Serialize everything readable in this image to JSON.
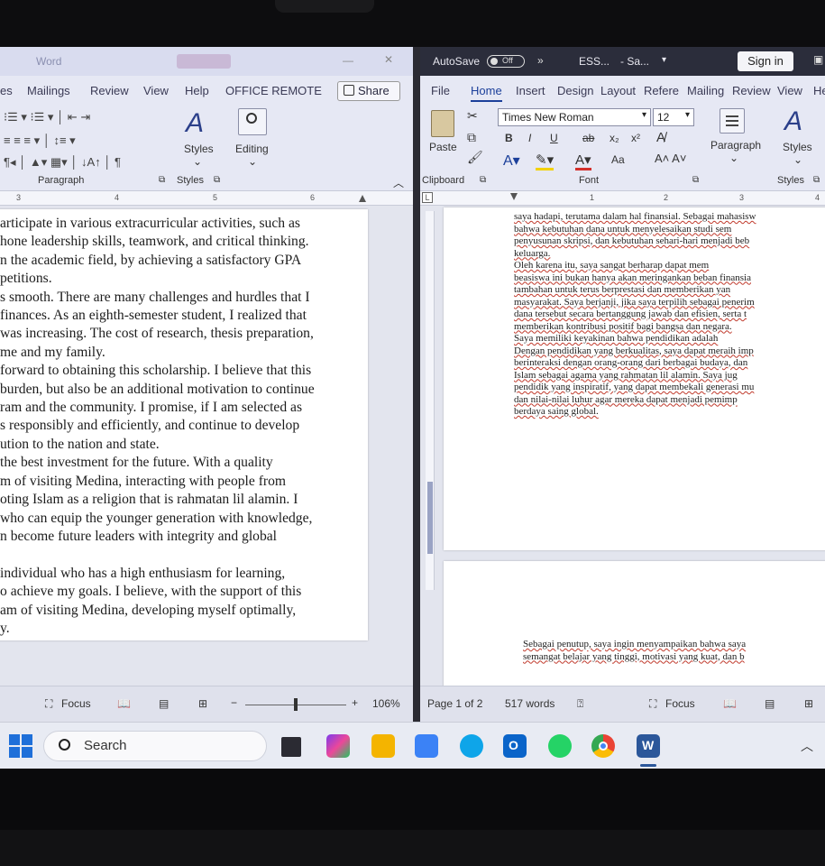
{
  "left_window": {
    "title_fragment": "Word",
    "menu_tabs": [
      "es",
      "Mailings",
      "Review",
      "View",
      "Help",
      "OFFICE REMOTE"
    ],
    "share_label": "Share",
    "groups": {
      "paragraph": "Paragraph",
      "styles_group": "Styles",
      "styles_button": "Styles",
      "editing_button": "Editing"
    },
    "ruler_marks": [
      "3",
      "4",
      "5",
      "6"
    ],
    "document_lines": [
      "articipate in various extracurricular activities, such as",
      "hone leadership skills, teamwork, and critical thinking.",
      "n the academic field, by achieving a satisfactory GPA",
      "petitions.",
      "s smooth. There are many challenges and hurdles that I",
      "finances. As an eighth-semester student, I realized that",
      "was increasing. The cost of research, thesis preparation,",
      "me and my family.",
      "forward to obtaining this scholarship. I believe that this",
      "burden, but also be an additional motivation to continue",
      "ram and the community. I promise, if I am selected as",
      "s responsibly and efficiently, and continue to develop",
      "ution to the nation and state.",
      "the best investment for the future. With a quality",
      "m of visiting Medina, interacting with people from",
      "oting Islam as a religion that is rahmatan lil alamin. I",
      "who can equip the younger generation with knowledge,",
      "n become future leaders with integrity and global",
      "",
      "individual who has a high enthusiasm for learning,",
      "o achieve my goals. I believe, with the support of this",
      "am of visiting Medina, developing myself optimally,",
      "y."
    ],
    "status": {
      "focus": "Focus",
      "zoom": "106%",
      "minus": "−",
      "plus": "+"
    }
  },
  "right_window": {
    "autosave": "AutoSave",
    "toggle": "Off",
    "doc_name": "ESS...",
    "saved": "- Sa...",
    "sign_in": "Sign in",
    "menu_tabs": [
      "File",
      "Home",
      "Insert",
      "Design",
      "Layout",
      "Refere",
      "Mailing",
      "Review",
      "View",
      "He"
    ],
    "clipboard": {
      "paste": "Paste",
      "label": "Clipboard"
    },
    "font": {
      "name": "Times New Roman",
      "size": "12",
      "label": "Font",
      "bold": "B",
      "italic": "I",
      "underline": "U",
      "strike": "ab",
      "sub": "x₂",
      "sup": "x²",
      "aa": "Aa"
    },
    "paragraph_button": "Paragraph",
    "styles_button": "Styles",
    "styles_label": "Styles",
    "ruler_marks": [
      "1",
      "2",
      "3",
      "4"
    ],
    "page1_lines": [
      "saya hadapi, terutama dalam hal finansial. Sebagai mahasisw",
      "bahwa kebutuhan dana untuk menyelesaikan studi sem",
      "penyusunan skripsi, dan kebutuhan sehari-hari menjadi beb",
      "keluarga.",
      "        Oleh karena itu, saya sangat berharap dapat mem",
      "beasiswa ini bukan hanya akan meringankan beban finansia",
      "tambahan untuk terus berprestasi dan memberikan yan",
      "masyarakat. Saya berjanji, jika saya terpilih sebagai penerim",
      "dana tersebut secara bertanggung jawab dan efisien, serta t",
      "memberikan kontribusi positif bagi bangsa dan negara.",
      "        Saya memiliki keyakinan bahwa pendidikan adalah",
      "Dengan pendidikan yang berkualitas, saya dapat meraih imp",
      "berinteraksi dengan orang-orang dari berbagai budaya, dan",
      "Islam sebagai agama yang rahmatan lil alamin. Saya jug",
      "pendidik yang inspiratif, yang dapat membekali generasi mu",
      "dan nilai-nilai luhur agar mereka dapat menjadi pemimp",
      "berdaya saing global."
    ],
    "page2_lines": [
      "Sebagai penutup, saya ingin menyampaikan bahwa saya",
      "semangat belajar yang tinggi, motivasi yang kuat, dan b"
    ],
    "status": {
      "page": "Page 1 of 2",
      "words": "517 words",
      "focus": "Focus"
    }
  },
  "taskbar": {
    "search_label": "Search",
    "colors": {
      "windows": "#1e6fd9",
      "files": "#f4b400",
      "store": "#3b82f6",
      "edge": "#0ea5e9",
      "outlook": "#0a64c9",
      "whatsapp": "#25d366",
      "chrome": "#ea4335",
      "word": "#2b579a"
    }
  }
}
